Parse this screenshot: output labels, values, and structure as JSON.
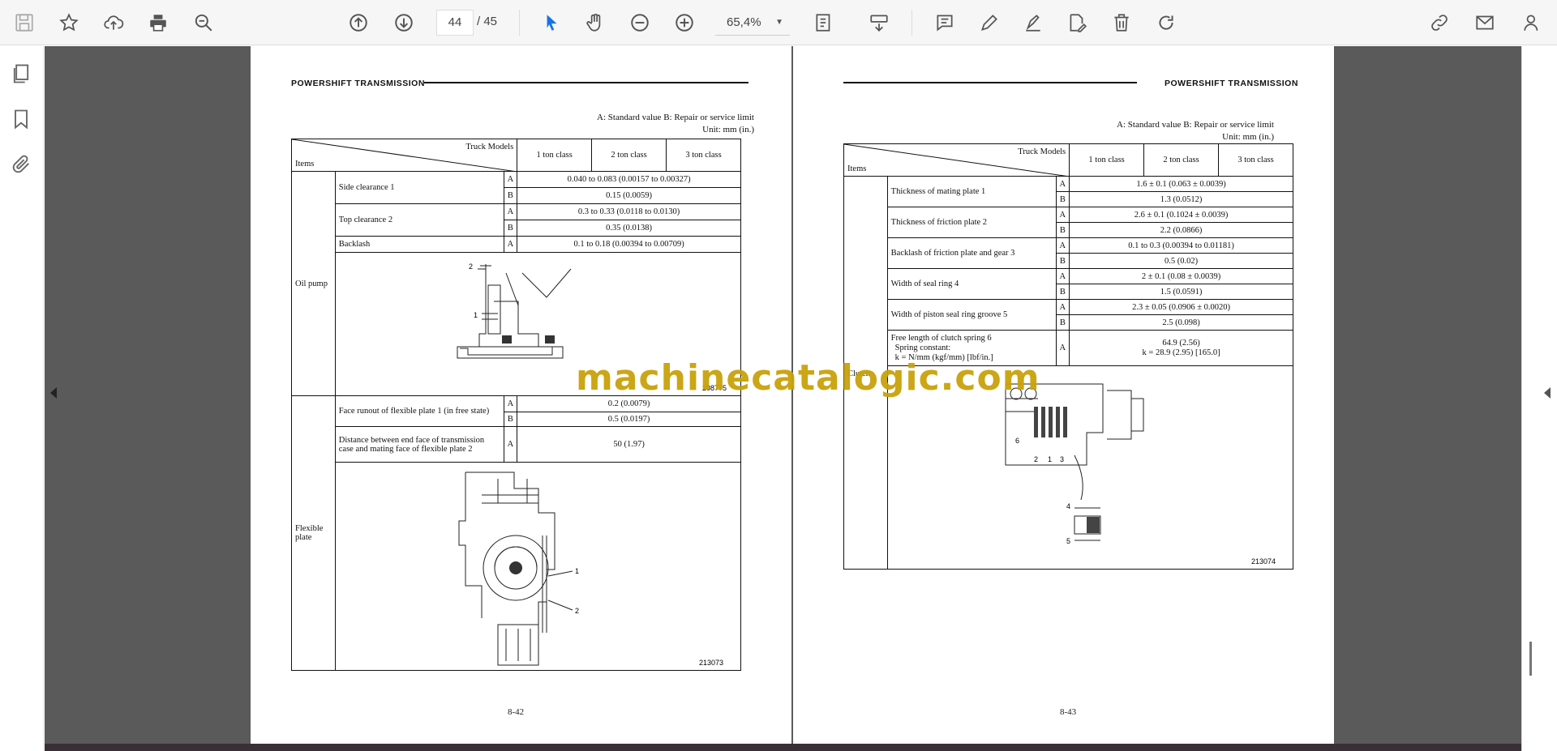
{
  "toolbar": {
    "current_page": "44",
    "page_sep": "/",
    "total_pages": "45",
    "zoom": "65,4%"
  },
  "left_page": {
    "header": "POWERSHIFT  TRANSMISSION",
    "legend": "A:  Standard value     B:  Repair or service limit",
    "unit": "Unit: mm (in.)",
    "col_truck_models": "Truck Models",
    "col_items": "Items",
    "classes": [
      "1 ton class",
      "2 ton class",
      "3 ton class"
    ],
    "oil_pump": "Oil pump",
    "flexible_plate": "Flexible plate",
    "rows": [
      {
        "item": "Side clearance 1",
        "ab": "A",
        "value": "0.040 to 0.083 (0.00157 to 0.00327)"
      },
      {
        "ab": "B",
        "value": "0.15 (0.0059)"
      },
      {
        "item": "Top clearance 2",
        "ab": "A",
        "value": "0.3 to 0.33 (0.0118 to 0.0130)"
      },
      {
        "ab": "B",
        "value": "0.35 (0.0138)"
      },
      {
        "item": "Backlash",
        "ab": "A",
        "value": "0.1 to 0.18 (0.00394 to 0.00709)"
      },
      {
        "item": "Face runout of flexible plate 1 (in free state)",
        "ab": "A",
        "value": "0.2 (0.0079)"
      },
      {
        "ab": "B",
        "value": "0.5 (0.0197)"
      },
      {
        "item": "Distance between end face of transmission case and mating face of flexible plate 2",
        "ab": "A",
        "value": "50 (1.97)"
      }
    ],
    "fig1_labels": [
      "2",
      "1",
      "208775"
    ],
    "fig2_labels": [
      "1",
      "2",
      "213073"
    ],
    "page_number": "8-42"
  },
  "right_page": {
    "header": "POWERSHIFT  TRANSMISSION",
    "legend": "A:  Standard value     B:  Repair or service limit",
    "unit": "Unit: mm (in.)",
    "col_truck_models": "Truck Models",
    "col_items": "Items",
    "classes": [
      "1 ton class",
      "2 ton class",
      "3 ton class"
    ],
    "clutch": "Clutch",
    "rows": [
      {
        "item": "Thickness of mating plate 1",
        "ab": "A",
        "value": "1.6 ± 0.1 (0.063 ± 0.0039)"
      },
      {
        "ab": "B",
        "value": "1.3 (0.0512)"
      },
      {
        "item": "Thickness of friction plate 2",
        "ab": "A",
        "value": "2.6 ± 0.1 (0.1024 ± 0.0039)"
      },
      {
        "ab": "B",
        "value": "2.2 (0.0866)"
      },
      {
        "item": "Backlash of friction plate and gear 3",
        "ab": "A",
        "value": "0.1 to 0.3 (0.00394 to 0.01181)"
      },
      {
        "ab": "B",
        "value": "0.5 (0.02)"
      },
      {
        "item": "Width of seal ring 4",
        "ab": "A",
        "value": "2 ± 0.1 (0.08 ± 0.0039)"
      },
      {
        "ab": "B",
        "value": "1.5 (0.0591)"
      },
      {
        "item": "Width of piston seal ring groove 5",
        "ab": "A",
        "value": "2.3 ± 0.05 (0.0906 ± 0.0020)"
      },
      {
        "ab": "B",
        "value": "2.5 (0.098)"
      }
    ],
    "spring_item": [
      "Free length of clutch spring 6",
      "Spring constant:",
      "k = N/mm (kgf/mm) [lbf/in.]"
    ],
    "spring_ab": "A",
    "spring_value": [
      "64.9 (2.56)",
      "k = 28.9 (2.95) [165.0]"
    ],
    "fig_labels": [
      "6",
      "2",
      "1",
      "3",
      "4",
      "5",
      "213074"
    ],
    "page_number": "8-43"
  },
  "watermark": "machinecatalogic.com"
}
